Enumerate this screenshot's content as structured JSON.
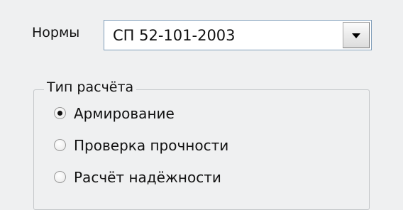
{
  "norms": {
    "label": "Нормы",
    "selected": "СП 52-101-2003",
    "arrow_icon": "chevron-down-icon"
  },
  "calc_type": {
    "title": "Тип расчёта",
    "options": [
      {
        "label": "Армирование",
        "checked": true
      },
      {
        "label": "Проверка прочности",
        "checked": false
      },
      {
        "label": "Расчёт надёжности",
        "checked": false
      }
    ]
  },
  "colors": {
    "background": "#eff0f1",
    "field_border": "#7f9db9",
    "group_border": "#c3c6c9"
  }
}
